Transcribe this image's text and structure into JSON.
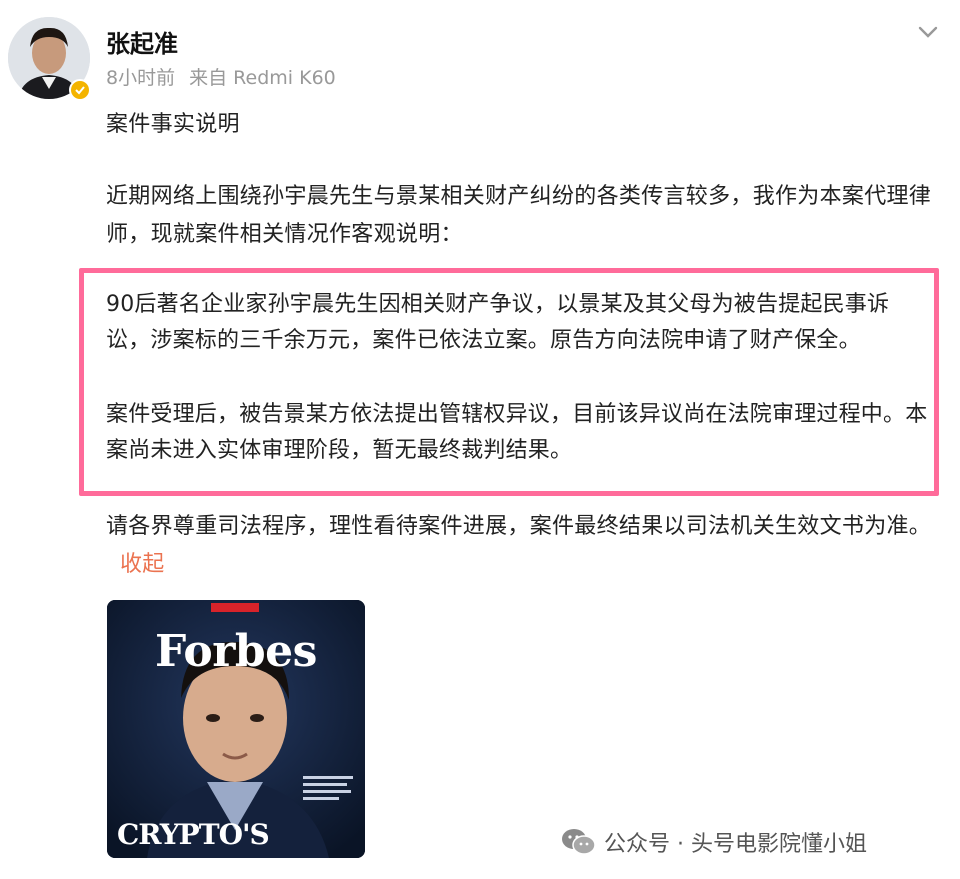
{
  "post": {
    "author": "张起准",
    "time": "8小时前",
    "source": "来自 Redmi K60",
    "title": "案件事实说明",
    "intro": "近期网络上围绕孙宇晨先生与景某相关财产纠纷的各类传言较多，我作为本案代理律师，现就案件相关情况作客观说明：",
    "highlight": {
      "para1": "90后著名企业家孙宇晨先生因相关财产争议，以景某及其父母为被告提起民事诉讼，涉案标的三千余万元，案件已依法立案。原告方向法院申请了财产保全。",
      "para2": "案件受理后，被告景某方依法提出管辖权异议，目前该异议尚在法院审理过程中。本案尚未进入实体审理阶段，暂无最终裁判结果。"
    },
    "closing": "请各界尊重司法程序，理性看待案件进展，案件最终结果以司法机关生效文书为准。",
    "collapse_label": "收起"
  },
  "image": {
    "brand": "Forbes",
    "headline": "CRYPTO'S"
  },
  "watermark": {
    "text": "公众号 · 头号电影院懂小姐",
    "icon": "wechat-icon"
  },
  "colors": {
    "highlight_border": "#ff6b9a",
    "link": "#eb7350",
    "verified": "#f4b400"
  }
}
